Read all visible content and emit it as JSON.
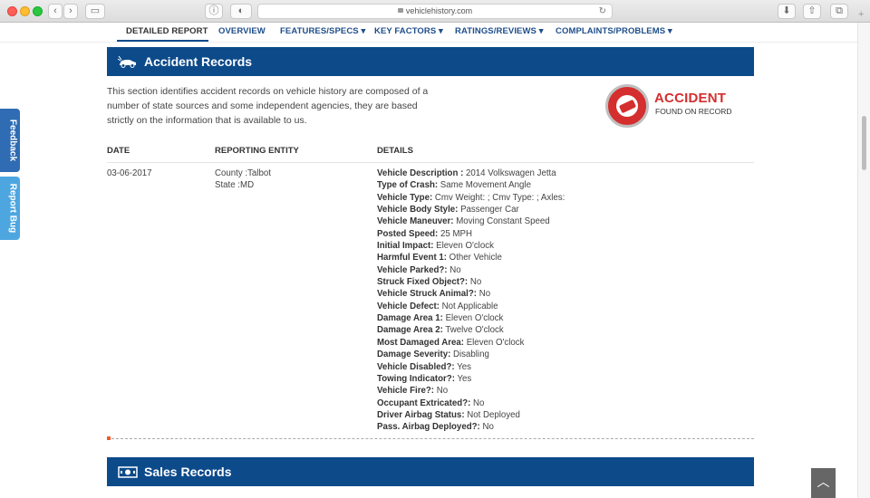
{
  "browser": {
    "url": "vehiclehistory.com"
  },
  "nav": {
    "items": [
      {
        "label": "DETAILED REPORT"
      },
      {
        "label": "OVERVIEW"
      },
      {
        "label": "FEATURES/SPECS ▾"
      },
      {
        "label": "KEY FACTORS ▾"
      },
      {
        "label": "RATINGS/REVIEWS ▾"
      },
      {
        "label": "COMPLAINTS/PROBLEMS ▾"
      }
    ]
  },
  "side_tabs": {
    "feedback": "Feedback",
    "report_bug": "Report Bug"
  },
  "accident_section": {
    "title": "Accident Records",
    "intro": "This section identifies accident records on vehicle history are composed of a number of state sources and some independent agencies, they are based strictly on the information that is available to us.",
    "badge_word": "ACCIDENT",
    "badge_sub": "FOUND ON RECORD",
    "columns": [
      "DATE",
      "REPORTING ENTITY",
      "DETAILS"
    ],
    "record": {
      "date": "03-06-2017",
      "county": "County :Talbot",
      "state": "State :MD",
      "details": [
        {
          "k": "Vehicle Description :",
          "v": " 2014 Volkswagen Jetta"
        },
        {
          "k": "Type of Crash:",
          "v": " Same Movement Angle"
        },
        {
          "k": "Vehicle Type:",
          "v": " Cmv Weight: ; Cmv Type: ; Axles:"
        },
        {
          "k": "Vehicle Body Style:",
          "v": " Passenger Car"
        },
        {
          "k": "Vehicle Maneuver:",
          "v": " Moving Constant Speed"
        },
        {
          "k": "Posted Speed:",
          "v": " 25 MPH"
        },
        {
          "k": "Initial Impact:",
          "v": " Eleven O'clock"
        },
        {
          "k": "Harmful Event 1:",
          "v": " Other Vehicle"
        },
        {
          "k": "Vehicle Parked?:",
          "v": " No"
        },
        {
          "k": "Struck Fixed Object?:",
          "v": " No"
        },
        {
          "k": "Vehicle Struck Animal?:",
          "v": " No"
        },
        {
          "k": "Vehicle Defect:",
          "v": " Not Applicable"
        },
        {
          "k": "Damage Area 1:",
          "v": " Eleven O'clock"
        },
        {
          "k": "Damage Area 2:",
          "v": " Twelve O'clock"
        },
        {
          "k": "Most Damaged Area:",
          "v": " Eleven O'clock"
        },
        {
          "k": "Damage Severity:",
          "v": " Disabling"
        },
        {
          "k": "Vehicle Disabled?:",
          "v": " Yes"
        },
        {
          "k": "Towing Indicator?:",
          "v": " Yes"
        },
        {
          "k": "Vehicle Fire?:",
          "v": " No"
        },
        {
          "k": "Occupant Extricated?:",
          "v": " No"
        },
        {
          "k": "Driver Airbag Status:",
          "v": " Not Deployed"
        },
        {
          "k": "Pass. Airbag Deployed?:",
          "v": " No"
        }
      ]
    }
  },
  "sales_section": {
    "title": "Sales Records"
  },
  "colors": {
    "header_blue": "#0c4a8a",
    "nav_blue": "#1f4e8c",
    "accident_red": "#d42e2e",
    "feedback_blue": "#2f6cb3",
    "report_bug_blue": "#4ea6e0"
  }
}
